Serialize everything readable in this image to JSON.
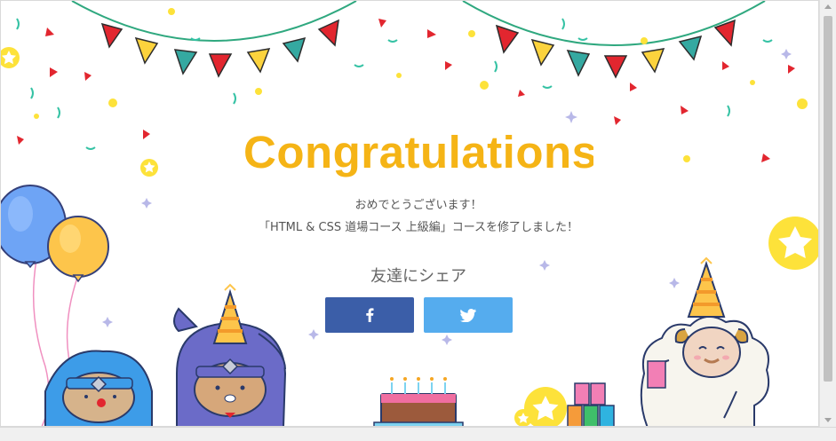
{
  "page": {
    "title": "Congratulations",
    "message_line1": "おめでとうございます！",
    "message_line2": "「HTML & CSS 道場コース 上級編」コースを修了しました！"
  },
  "share": {
    "heading": "友達にシェア",
    "buttons": [
      {
        "network": "facebook",
        "icon": "facebook-icon",
        "color": "#3b5ea8"
      },
      {
        "network": "twitter",
        "icon": "twitter-icon",
        "color": "#55acee"
      }
    ]
  },
  "colors": {
    "title": "#f5b416",
    "flag_red": "#e2262f",
    "flag_yellow": "#fcd33d",
    "flag_teal": "#35a9a1",
    "confetti_yellow": "#fde23a"
  }
}
